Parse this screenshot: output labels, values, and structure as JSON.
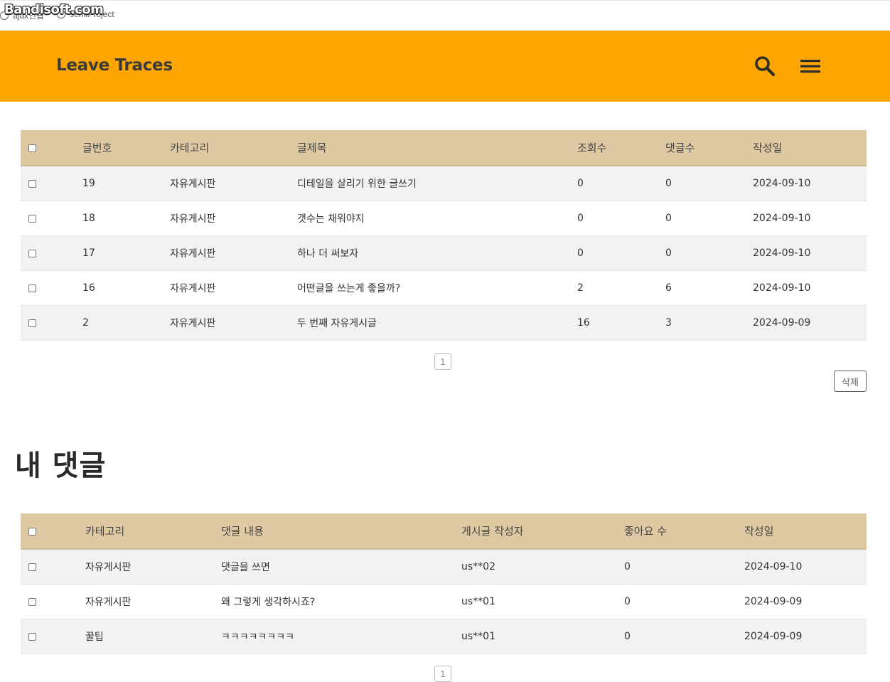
{
  "bookmarks": {
    "watermark": "Bandisoft.com",
    "items": [
      {
        "label": "ajax연습"
      },
      {
        "label": "semiProject"
      }
    ]
  },
  "header": {
    "logo": "Leave Traces",
    "search_icon": "search-icon",
    "menu_icon": "hamburger-menu-icon",
    "background": "#ffa500"
  },
  "posts": {
    "columns": [
      "글번호",
      "카테고리",
      "글제목",
      "조회수",
      "댓글수",
      "작성일"
    ],
    "rows": [
      {
        "no": "19",
        "category": "자유게시판",
        "title": "디테일을 살리기 위한 글쓰기",
        "views": "0",
        "comments": "0",
        "date": "2024-09-10"
      },
      {
        "no": "18",
        "category": "자유게시판",
        "title": "갯수는 채워야지",
        "views": "0",
        "comments": "0",
        "date": "2024-09-10"
      },
      {
        "no": "17",
        "category": "자유게시판",
        "title": "하나 더 써보자",
        "views": "0",
        "comments": "0",
        "date": "2024-09-10"
      },
      {
        "no": "16",
        "category": "자유게시판",
        "title": "어떤글을 쓰는게 좋을까?",
        "views": "2",
        "comments": "6",
        "date": "2024-09-10"
      },
      {
        "no": "2",
        "category": "자유게시판",
        "title": "두 번째 자유게시글",
        "views": "16",
        "comments": "3",
        "date": "2024-09-09"
      }
    ],
    "page": "1",
    "delete_label": "삭제"
  },
  "comments_section": {
    "title": "내 댓글",
    "columns": [
      "카테고리",
      "댓글 내용",
      "게시글 작성자",
      "좋아요 수",
      "작성일"
    ],
    "rows": [
      {
        "category": "자유게시판",
        "content": "댓글을 쓰면",
        "author": "us**02",
        "likes": "0",
        "date": "2024-09-10"
      },
      {
        "category": "자유게시판",
        "content": "왜 그렇게 생각하시죠?",
        "author": "us**01",
        "likes": "0",
        "date": "2024-09-09"
      },
      {
        "category": "꿀팁",
        "content": "ㅋㅋㅋㅋㅋㅋㅋㅋ",
        "author": "us**01",
        "likes": "0",
        "date": "2024-09-09"
      }
    ],
    "page": "1"
  },
  "colors": {
    "header_row": "#dfc9a3",
    "odd_row": "#f2f2f2"
  }
}
